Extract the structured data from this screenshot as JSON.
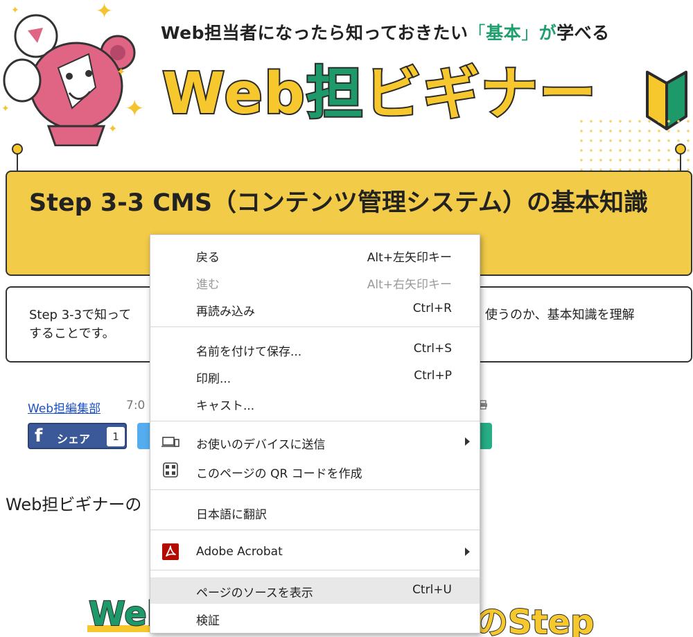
{
  "header": {
    "tagline_pre": "Web担当者になったら知っておきたい",
    "tagline_open": "「",
    "tagline_kihon": "基本",
    "tagline_close": "」",
    "tagline_ga": "が",
    "tagline_post": "学べる",
    "logo_web": "Web",
    "logo_tan": "担",
    "logo_beginner": "ビギナー",
    "logo_dash": "ー"
  },
  "title": "Step 3-3 CMS（コンテンツ管理システム）の基本知識",
  "description": {
    "left_line1": "Step 3-3で知って",
    "left_line2": "することです。",
    "right_line1": "使うのか、基本知識を理解"
  },
  "meta": {
    "author": "Web担編集部",
    "time": "7:0"
  },
  "share": {
    "fb_icon": "f",
    "fb_label": "シェア",
    "fb_count": "1"
  },
  "intro": "Web担ビギナーの",
  "bottom": {
    "left": "Web",
    "right": "のStep"
  },
  "context_menu": {
    "items": [
      {
        "label": "戻る",
        "shortcut": "Alt+左矢印キー"
      },
      {
        "label": "進む",
        "shortcut": "Alt+右矢印キー"
      },
      {
        "label": "再読み込み",
        "shortcut": "Ctrl+R"
      },
      {
        "label": "名前を付けて保存...",
        "shortcut": "Ctrl+S"
      },
      {
        "label": "印刷...",
        "shortcut": "Ctrl+P"
      },
      {
        "label": "キャスト..."
      },
      {
        "label": "お使いのデバイスに送信",
        "icon": "send-to-device-icon"
      },
      {
        "label": "このページの QR コードを作成",
        "icon": "qr-code-icon"
      },
      {
        "label": "日本語に翻訳"
      },
      {
        "label": "Adobe Acrobat",
        "icon": "adobe-acrobat-icon"
      },
      {
        "label": "ページのソースを表示",
        "shortcut": "Ctrl+U"
      },
      {
        "label": "検証"
      }
    ]
  },
  "colors": {
    "brand_yellow": "#f2cb48",
    "brand_green": "#1e9a6a",
    "facebook": "#3b5998",
    "twitter": "#55acee",
    "menu_hover": "#e8e8e8",
    "acrobat_red": "#b30b00"
  }
}
